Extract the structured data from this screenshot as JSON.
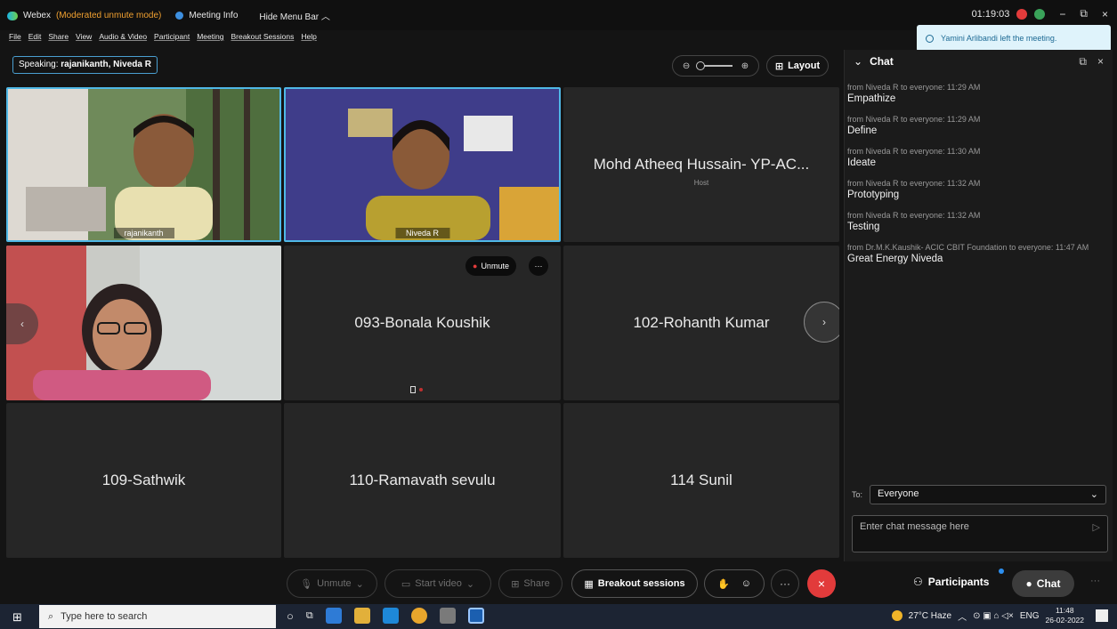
{
  "titlebar": {
    "app": "Webex",
    "mode": "(Moderated unmute mode)",
    "meeting_info": "Meeting Info",
    "hide_menu": "Hide Menu Bar",
    "timer": "01:19:03",
    "minimize": "−",
    "restore": "⧉",
    "close": "×"
  },
  "menu": [
    "File",
    "Edit",
    "Share",
    "View",
    "Audio & Video",
    "Participant",
    "Meeting",
    "Breakout Sessions",
    "Help"
  ],
  "notification": "Yamini Arlibandi left the meeting.",
  "speaking": {
    "label": "Speaking: ",
    "names": "rajanikanth, Niveda R"
  },
  "layout_label": "Layout",
  "tiles": {
    "t1": "rajanikanth",
    "t2": "Niveda R",
    "t3_name": "Mohd Atheeq Hussain- YP-AC...",
    "t3_role": "Host",
    "t5_name": "093-Bonala Koushik",
    "t5_unmute": "Unmute",
    "t6_name": "102-Rohanth Kumar",
    "t7_name": "109-Sathwik",
    "t8_name": "110-Ramavath sevulu",
    "t9_name": "114 Sunil"
  },
  "chat": {
    "title": "Chat",
    "messages": [
      {
        "meta": "from Niveda R to everyone:   11:29 AM",
        "text": "Empathize"
      },
      {
        "meta": "from Niveda R to everyone:   11:29 AM",
        "text": "Define"
      },
      {
        "meta": "from Niveda R to everyone:   11:30 AM",
        "text": "Ideate"
      },
      {
        "meta": "from Niveda R to everyone:   11:32 AM",
        "text": "Prototyping"
      },
      {
        "meta": "from Niveda R to everyone:   11:32 AM",
        "text": "Testing"
      },
      {
        "meta": "from Dr.M.K.Kaushik- ACIC CBIT Foundation to everyone: 11:47 AM",
        "text": "Great Energy Niveda"
      }
    ],
    "to_label": "To:",
    "to_value": "Everyone",
    "input_placeholder": "Enter chat message here"
  },
  "controls": {
    "unmute": "Unmute",
    "start_video": "Start video",
    "share": "Share",
    "breakout": "Breakout sessions",
    "participants": "Participants",
    "chat": "Chat"
  },
  "taskbar": {
    "search_placeholder": "Type here to search",
    "weather": "27°C  Haze",
    "lang": "ENG",
    "time": "11:48",
    "date": "26-02-2022"
  },
  "colors": {
    "accent": "#4fb8e6",
    "leave": "#e23b3b",
    "mode": "#f0a030"
  }
}
